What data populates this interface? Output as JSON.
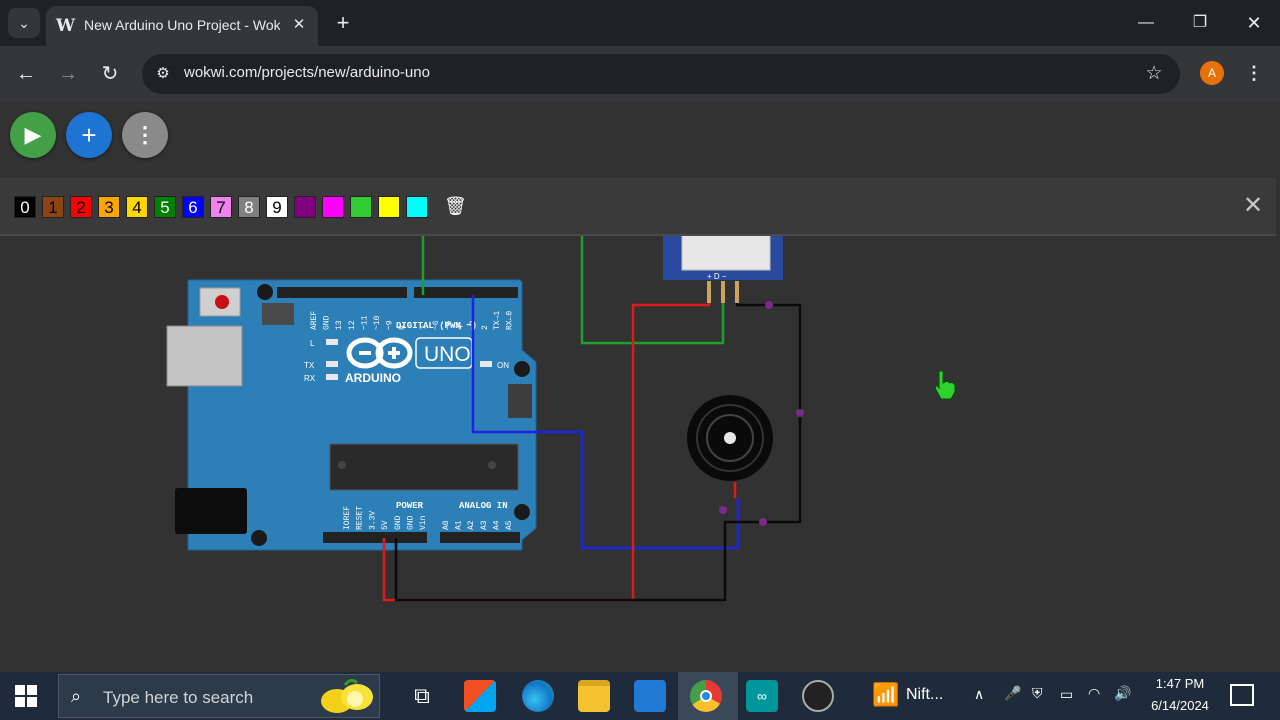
{
  "browser": {
    "tab_title": "New Arduino Uno Project - Wokwi",
    "tab_favicon": "W",
    "new_tab_glyph": "+",
    "close_glyph": "✕",
    "url": "wokwi.com/projects/new/arduino-uno",
    "profile_initial": "A"
  },
  "wokwi": {
    "fab_buttons": [
      {
        "name": "play",
        "glyph": "▶",
        "color": "#43a047"
      },
      {
        "name": "add",
        "glyph": "+",
        "color": "#1e74d2"
      },
      {
        "name": "more",
        "glyph": "⋮",
        "color": "#8a8a8a"
      }
    ],
    "wire_colors": [
      {
        "label": "0",
        "color": "#000000",
        "text": "#ffffff"
      },
      {
        "label": "1",
        "color": "#8b4513",
        "text": "#000000"
      },
      {
        "label": "2",
        "color": "#ff0000",
        "text": "#000000"
      },
      {
        "label": "3",
        "color": "#ffa500",
        "text": "#000000"
      },
      {
        "label": "4",
        "color": "#ffd700",
        "text": "#000000"
      },
      {
        "label": "5",
        "color": "#008000",
        "text": "#ffffff"
      },
      {
        "label": "6",
        "color": "#0000ff",
        "text": "#ffffff"
      },
      {
        "label": "7",
        "color": "#ee82ee",
        "text": "#000000"
      },
      {
        "label": "8",
        "color": "#808080",
        "text": "#ffffff"
      },
      {
        "label": "9",
        "color": "#ffffff",
        "text": "#000000"
      },
      {
        "label": "",
        "color": "#800080",
        "text": "#ffffff"
      },
      {
        "label": "",
        "color": "#ff00ff",
        "text": "#ffffff"
      },
      {
        "label": "",
        "color": "#32cd32",
        "text": "#ffffff"
      },
      {
        "label": "",
        "color": "#ffff00",
        "text": "#ffffff"
      },
      {
        "label": "",
        "color": "#00ffff",
        "text": "#ffffff"
      }
    ],
    "board": {
      "logo_text": "ARDUINO",
      "model": "UNO",
      "digital_label": "DIGITAL (PWM ~)",
      "power_label": "POWER",
      "analog_label": "ANALOG IN",
      "on_label": "ON",
      "led_l": "L",
      "led_tx": "TX",
      "led_rx": "RX",
      "top_pins": [
        "AREF",
        "GND",
        "13",
        "12",
        "~11",
        "~10",
        "~9",
        "8",
        "7",
        "~6",
        "~5",
        "4",
        "~3",
        "2",
        "TX→1",
        "RX←0"
      ],
      "bottom_pins": [
        "IOREF",
        "RESET",
        "3.3V",
        "5V",
        "GND",
        "GND",
        "Vin",
        "A0",
        "A1",
        "A2",
        "A3",
        "A4",
        "A5"
      ]
    },
    "pir_pins": "+ D −",
    "wire_palette": {
      "green": "#1f9d2e",
      "blue": "#1a24e6",
      "red": "#e01b1b",
      "black": "#0a0a0a"
    }
  },
  "taskbar": {
    "search_placeholder": "Type here to search",
    "nifty_label": "Nift...",
    "time": "1:47 PM",
    "date": "6/14/2024"
  }
}
